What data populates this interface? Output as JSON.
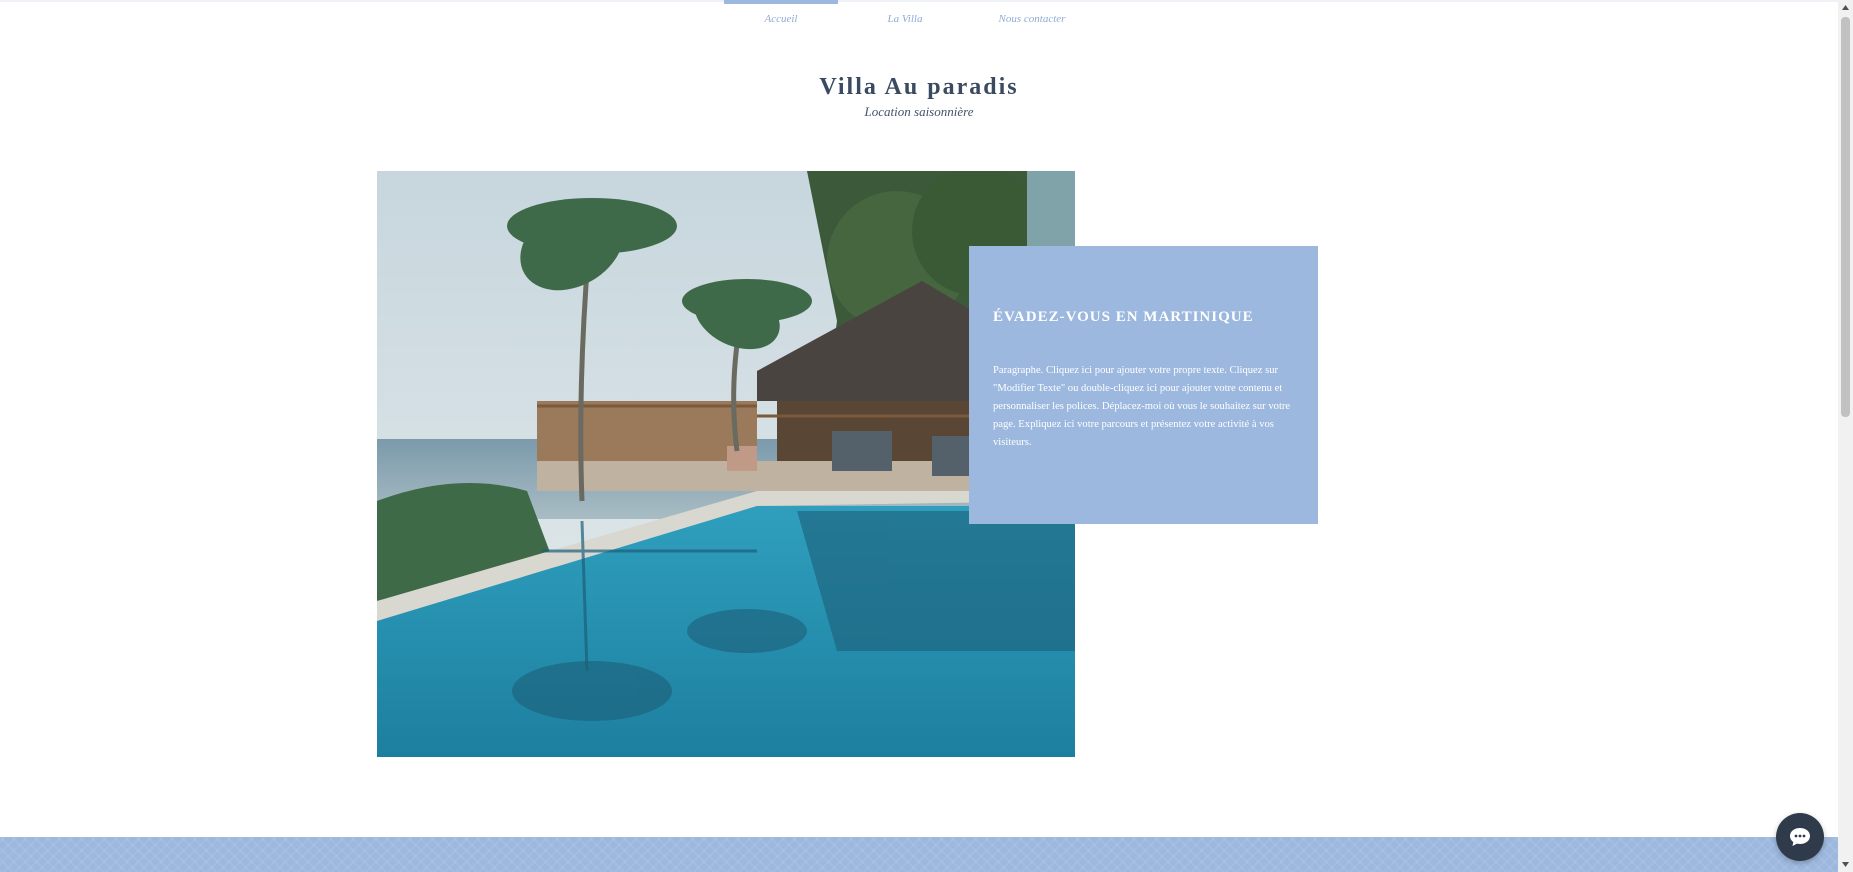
{
  "nav": {
    "items": [
      {
        "label": "Accueil",
        "active": true
      },
      {
        "label": "La Villa",
        "active": false
      },
      {
        "label": "Nous contacter",
        "active": false
      }
    ]
  },
  "header": {
    "title": "Villa Au paradis",
    "subtitle": "Location saisonnière"
  },
  "hero": {
    "image": "villa-infinity-pool-photo",
    "card": {
      "heading": "ÉVADEZ-VOUS EN MARTINIQUE",
      "paragraph": "Paragraphe. Cliquez ici pour ajouter votre propre texte. Cliquez sur \"Modifier Texte\" ou double-cliquez ici pour ajouter votre contenu et personnaliser les polices. Déplacez-moi où vous le souhaitez sur votre page. Expliquez ici votre parcours et présentez votre activité à vos visiteurs."
    }
  },
  "chat": {
    "icon": "chat-bubble-icon"
  },
  "colors": {
    "accent": "#9cb8de",
    "nav_text": "#8fabd3",
    "title_text": "#3a4a60",
    "chat_button": "#2f3a4a",
    "pool": "#2f9fbd"
  }
}
